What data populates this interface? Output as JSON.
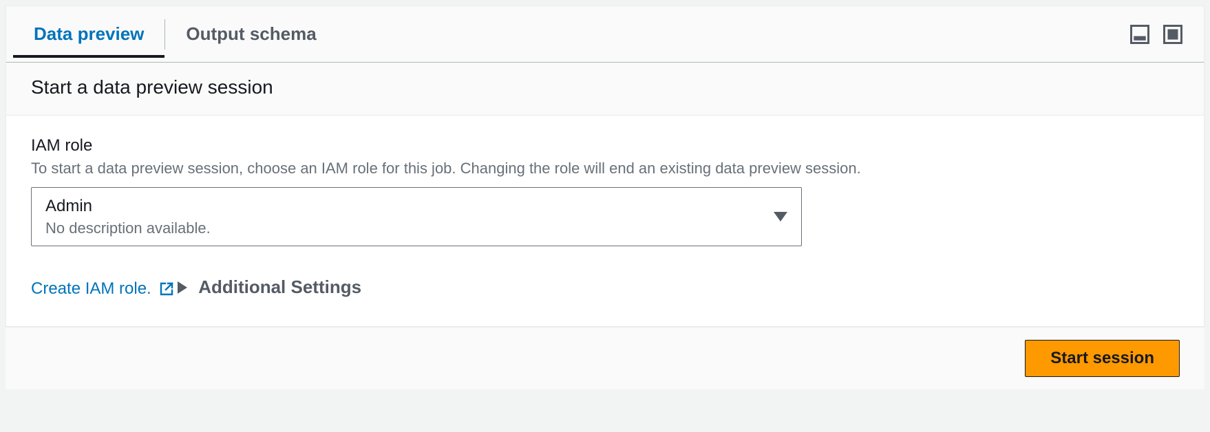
{
  "tabs": {
    "data_preview": "Data preview",
    "output_schema": "Output schema"
  },
  "section": {
    "title": "Start a data preview session"
  },
  "iam": {
    "label": "IAM role",
    "help": "To start a data preview session, choose an IAM role for this job. Changing the role will end an existing data preview session.",
    "selected_value": "Admin",
    "selected_desc": "No description available.",
    "create_link": "Create IAM role."
  },
  "additional": {
    "label": "Additional Settings"
  },
  "footer": {
    "start_btn": "Start session"
  }
}
